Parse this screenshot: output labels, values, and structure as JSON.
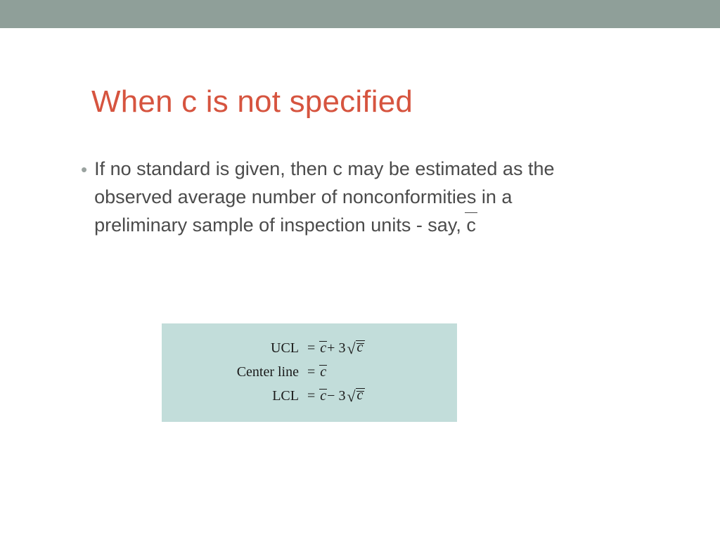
{
  "title": "When c is not specified",
  "bullet": {
    "text_before_cbar": "If no standard is given, then c may be estimated as the observed average number of nonconformities in a preliminary sample of inspection units - say, ",
    "cbar": "c"
  },
  "formulas": {
    "ucl_label": "UCL",
    "center_label": "Center line",
    "lcl_label": "LCL",
    "eq": "=",
    "cbar": "c",
    "plus3": " + 3",
    "minus3": " − 3",
    "sqrt_c": "c"
  }
}
